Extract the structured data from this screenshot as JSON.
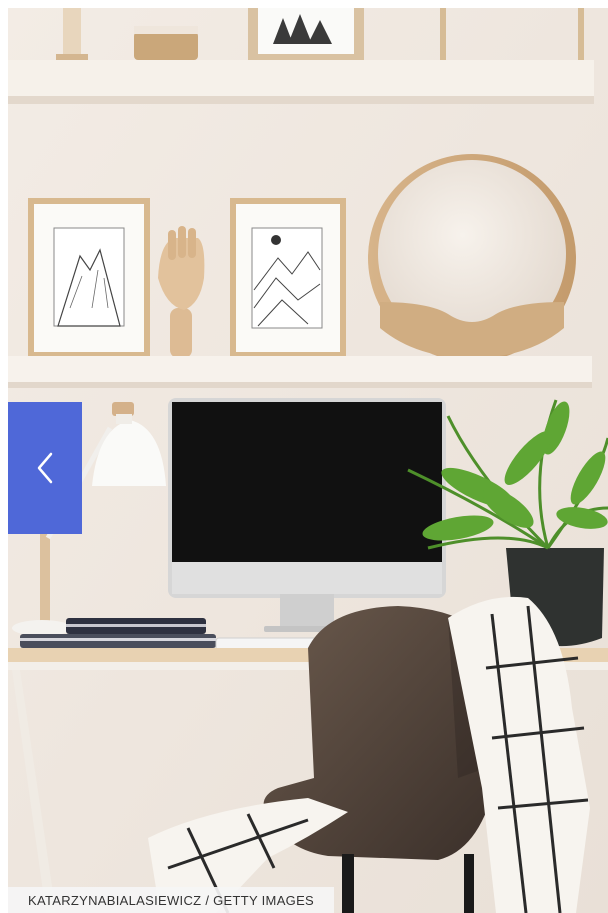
{
  "gallery": {
    "photo_alt": "Home office with shelves, framed prints, desk and chair",
    "prev_icon": "chevron-left-icon",
    "credit": "KATARZYNABIALASIEWICZ / GETTY IMAGES"
  },
  "colors": {
    "nav_button": "#4f68d8",
    "wall": "#efe7df"
  }
}
